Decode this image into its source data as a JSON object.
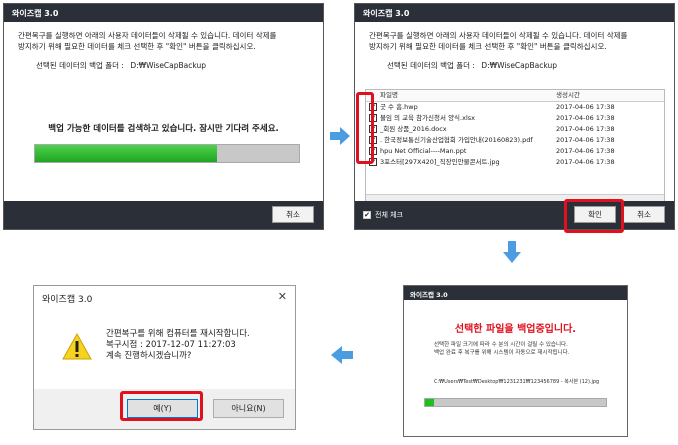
{
  "panel1": {
    "title": "와이즈캡 3.0",
    "desc_line1": "간편복구를 실행하면 아래의 사용자 데이터들이 삭제될 수 있습니다. 데이터 삭제를",
    "desc_line2": "방지하기 위해 필요한 데이터를 체크 선택한 후 \"확인\" 버튼을 클릭하십시오.",
    "folder_label": "선택된 데이터의 백업 폴더 :",
    "folder_path": "D:₩WiseCapBackup",
    "status": "백업 가능한 데이터를 검색하고 있습니다.  잠시만 기다려 주세요.",
    "progress": 0.69,
    "cancel_label": "취소"
  },
  "panel2": {
    "title": "와이즈캡 3.0",
    "desc_line1": "간편복구를 실행하면 아래의 사용자 데이터들이 삭제될 수 있습니다. 데이터 삭제를",
    "desc_line2": "방지하기 위해 필요한 데이터를 체크 선택한 후 \"확인\" 버튼을 클릭하십시오.",
    "folder_label": "선택된 데이터의 백업 폴더 :",
    "folder_path": "D:₩WiseCapBackup",
    "col_name": "파일명",
    "col_time": "생성시간",
    "files": [
      {
        "name": "굿 수 흠.hwp",
        "time": "2017-04-06 17:38"
      },
      {
        "name": "불임 의 교육 참가신청서 양식.xlsx",
        "time": "2017-04-06 17:38"
      },
      {
        "name": "_회원 상품_2016.docx",
        "time": "2017-04-06 17:38"
      },
      {
        "name": ". 한국정보통신기술산업협회 가입안내(20160823).pdf",
        "time": "2017-04-06 17:38"
      },
      {
        "name": "hpu Net Official----Man.ppt",
        "time": "2017-04-06 17:38"
      },
      {
        "name": "3포스터[297X420]_직장인안물콘서트.jpg",
        "time": "2017-04-06 17:38"
      }
    ],
    "select_all_label": "전체 체크",
    "confirm_label": "확인",
    "cancel_label": "취소"
  },
  "panel3": {
    "title": "와이즈캡 3.0",
    "line1": "간편복구를 위해 컴퓨터를 재시작합니다.",
    "line2": "복구시점 : 2017-12-07 11:27:03",
    "line3": "계속 진행하시겠습니까?",
    "yes_label": "예(Y)",
    "no_label": "아니요(N)"
  },
  "panel4": {
    "title": "와이즈캡 3.0",
    "headline": "선택한 파일을 백업중입니다.",
    "info_line1": "선택한 파일 크기에 따라 수 분의 시간이 걸릴 수 있습니다.",
    "info_line2": "백업 완료 후 복구를 위해 시스템이 자동으로 재시작됩니다.",
    "current_path": "C:₩Users₩Test₩Desktop₩1231231₩123456789 - 복사본 (12).jpg",
    "progress": 0.05
  },
  "colors": {
    "titlebar": "#2b3038",
    "highlight": "#e0101e",
    "progress": "#1fa51f",
    "arrow": "#4a9de0"
  }
}
